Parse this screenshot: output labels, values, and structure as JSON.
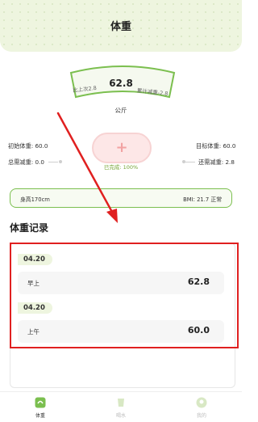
{
  "header": {
    "title": "体重"
  },
  "gauge": {
    "current": "62.8",
    "left_label": "比上次2.8",
    "right_label": "累计减重-2.8",
    "unit": "公斤"
  },
  "stats": {
    "initial": "初始体重: 60.0",
    "target": "目标体重: 60.0",
    "total_loss": "总需减重: 0.0",
    "remaining_loss": "还需减重: 2.8"
  },
  "progress": {
    "label": "已完成: 100%",
    "fraction": 1.0
  },
  "info": {
    "height": "身高170cm",
    "bmi": "BMI: 21.7 正常"
  },
  "records": {
    "section_title": "体重记录",
    "items": [
      {
        "date": "04.20",
        "label": "早上",
        "value": "62.8"
      },
      {
        "date": "04.20",
        "label": "上午",
        "value": "60.0"
      }
    ]
  },
  "nav": {
    "items": [
      {
        "label": "体重"
      },
      {
        "label": "喝水"
      },
      {
        "label": "我的"
      }
    ]
  },
  "colors": {
    "accent": "#7bbf4f",
    "header_bg": "#eef5df",
    "add_button": "#fde7e7",
    "highlight": "#e02020"
  }
}
